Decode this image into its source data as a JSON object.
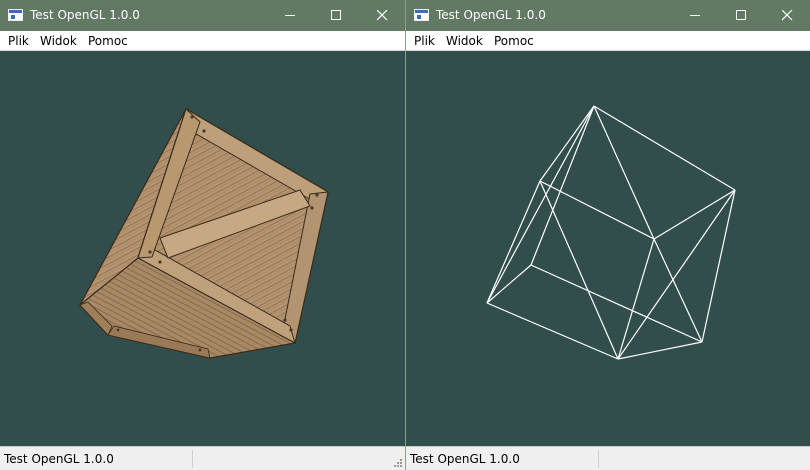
{
  "windows": [
    {
      "title": "Test OpenGL 1.0.0",
      "menu": [
        "Plik",
        "Widok",
        "Pomoc"
      ],
      "status": "Test OpenGL 1.0.0",
      "render_mode": "textured crate"
    },
    {
      "title": "Test OpenGL 1.0.0",
      "menu": [
        "Plik",
        "Widok",
        "Pomoc"
      ],
      "status": "Test OpenGL 1.0.0",
      "render_mode": "wireframe"
    }
  ],
  "colors": {
    "titlebar": "#627a63",
    "viewport_bg": "#324e4c",
    "crate_face": "#b79870",
    "crate_dark": "#7c5e3e",
    "wireframe": "#ffffff"
  },
  "icons": {
    "app": "app-window-icon",
    "minimize": "minimize-icon",
    "maximize": "maximize-icon",
    "close": "close-icon",
    "grip": "resize-grip-icon"
  }
}
